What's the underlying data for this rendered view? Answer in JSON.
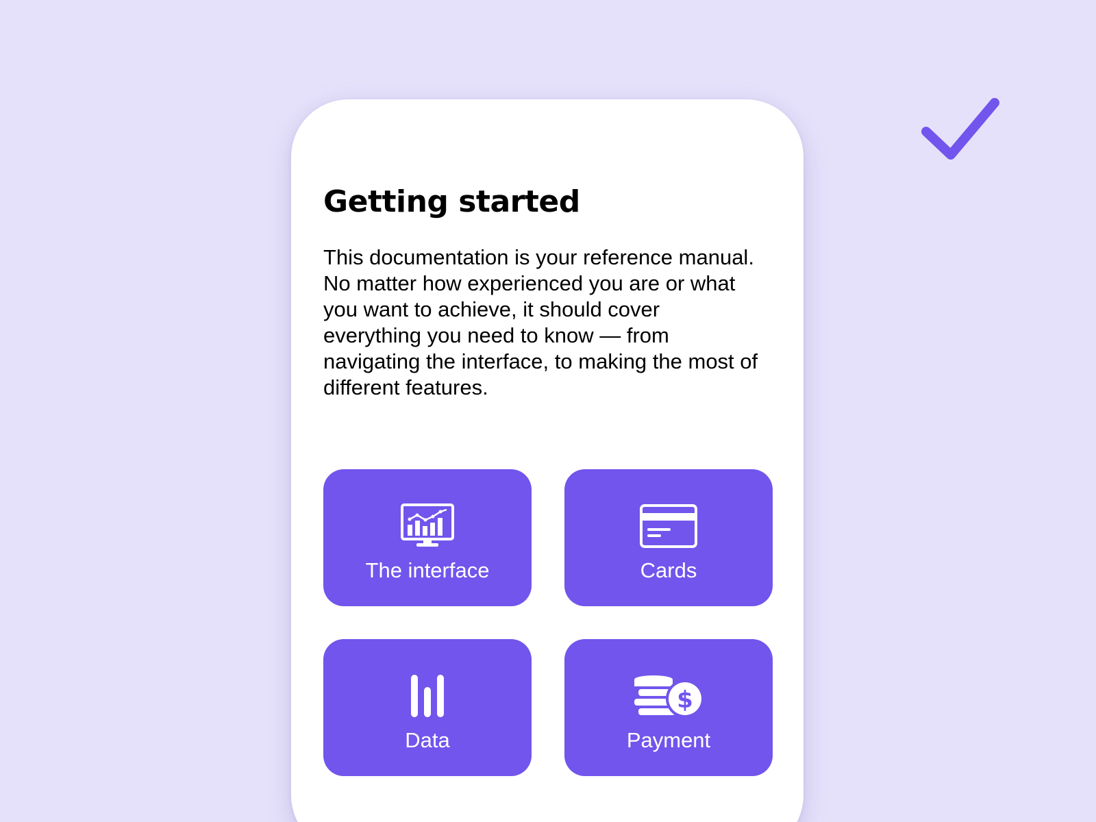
{
  "page": {
    "title": "Getting started",
    "intro": "This documentation is your reference manual. No matter how experienced you are or what you want to achieve, it should cover everything you need to know — from navigating the interface, to making the most of different features."
  },
  "tiles": [
    {
      "label": "The interface",
      "icon": "monitor-chart-icon"
    },
    {
      "label": "Cards",
      "icon": "credit-card-icon"
    },
    {
      "label": "Data",
      "icon": "bar-chart-icon"
    },
    {
      "label": "Payment",
      "icon": "coins-dollar-icon"
    }
  ],
  "decor": {
    "check_icon": "checkmark-icon"
  },
  "colors": {
    "background": "#e6e1fb",
    "accent": "#7155ec",
    "card": "#ffffff",
    "text": "#000000"
  }
}
